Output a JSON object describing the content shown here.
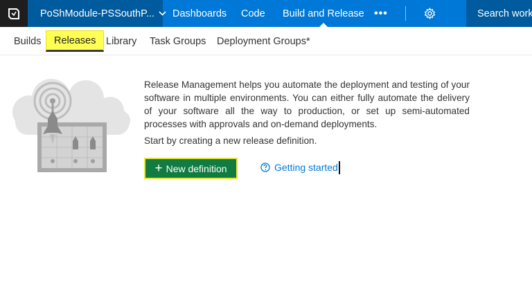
{
  "topbar": {
    "project": "PoShModule-PSSouthP...",
    "nav": [
      "Dashboards",
      "Code",
      "Build and Release"
    ],
    "active_nav": "Build and Release",
    "more": "•••",
    "search": "Search work"
  },
  "subnav": {
    "tabs": [
      "Builds",
      "Releases",
      "Library",
      "Task Groups",
      "Deployment Groups*"
    ],
    "active": "Releases"
  },
  "content": {
    "description": "Release Management helps you automate the deployment and testing of your software in multiple environments. You can either fully automate the delivery of your software all the way to production, or set up semi-automated processes with approvals and on-demand deployments.",
    "start_text": "Start by creating a new release definition.",
    "new_definition_plus": "+",
    "new_definition_label": "New definition",
    "getting_started": "Getting started"
  },
  "colors": {
    "topbar_blue": "#0078d7",
    "project_dark_blue": "#005a9e",
    "logo_bg": "#1e1e1e",
    "button_green": "#107c41",
    "highlight_yellow": "#ffff55",
    "link_blue": "#0078d7"
  },
  "icons": {
    "logo": "vsts-logo-icon",
    "project_dropdown": "chevron-down-icon",
    "settings": "gear-icon",
    "help": "question-circle-icon",
    "add": "plus-icon",
    "illustration": "release-illustration"
  }
}
